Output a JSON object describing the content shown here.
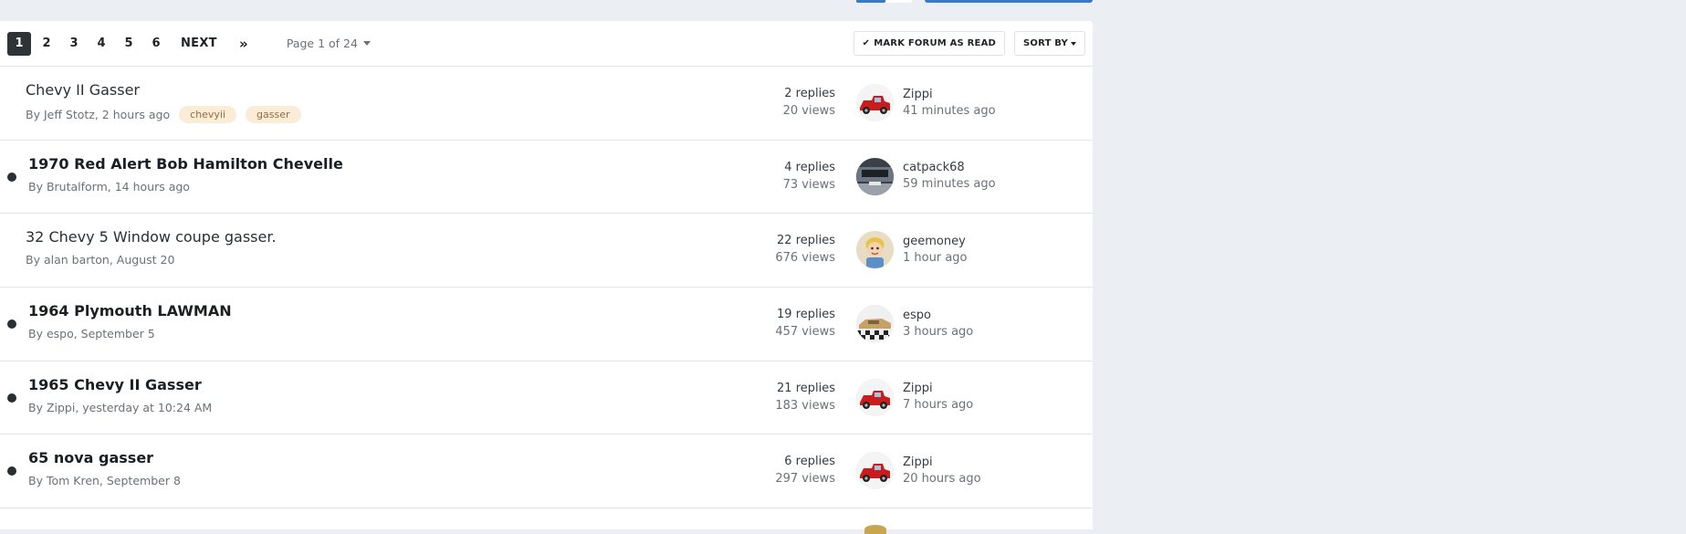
{
  "pagination": {
    "pages": [
      "1",
      "2",
      "3",
      "4",
      "5",
      "6"
    ],
    "active": "1",
    "next_label": "NEXT",
    "last_label": "»",
    "page_jump_label": "Page 1 of 24"
  },
  "toolbar": {
    "mark_read_label": "MARK FORUM AS READ",
    "sort_label": "SORT BY"
  },
  "topics": [
    {
      "title": "Chevy II Gasser",
      "unread": false,
      "byline": "By Jeff Stotz, 2 hours ago",
      "tags": [
        "chevyii",
        "gasser"
      ],
      "replies": "2 replies",
      "views": "20 views",
      "last_user": "Zippi",
      "last_time": "41 minutes ago",
      "avatar_icon": "red-truck-avatar"
    },
    {
      "title": "1970 Red Alert Bob Hamilton Chevelle",
      "unread": true,
      "byline": "By Brutalform, 14 hours ago",
      "tags": [],
      "replies": "4 replies",
      "views": "73 views",
      "last_user": "catpack68",
      "last_time": "59 minutes ago",
      "avatar_icon": "dark-car-avatar"
    },
    {
      "title": "32 Chevy 5 Window coupe gasser.",
      "unread": false,
      "byline": "By alan barton, August 20",
      "tags": [],
      "replies": "22 replies",
      "views": "676 views",
      "last_user": "geemoney",
      "last_time": "1 hour ago",
      "avatar_icon": "cartoon-boy-avatar"
    },
    {
      "title": "1964 Plymouth LAWMAN",
      "unread": true,
      "byline": "By espo, September 5",
      "tags": [],
      "replies": "19 replies",
      "views": "457 views",
      "last_user": "espo",
      "last_time": "3 hours ago",
      "avatar_icon": "gold-car-checker-avatar"
    },
    {
      "title": "1965 Chevy II Gasser",
      "unread": true,
      "byline": "By Zippi, yesterday at 10:24 AM",
      "tags": [],
      "replies": "21 replies",
      "views": "183 views",
      "last_user": "Zippi",
      "last_time": "7 hours ago",
      "avatar_icon": "red-truck-avatar"
    },
    {
      "title": "65 nova gasser",
      "unread": true,
      "byline": "By Tom Kren, September 8",
      "tags": [],
      "replies": "6 replies",
      "views": "297 views",
      "last_user": "Zippi",
      "last_time": "20 hours ago",
      "avatar_icon": "red-truck-avatar"
    }
  ],
  "colors": {
    "page_bg": "#ebeef2",
    "active_page": "#2e3338",
    "tag_bg": "#fbecd8",
    "accent_blue": "#3979c5"
  }
}
